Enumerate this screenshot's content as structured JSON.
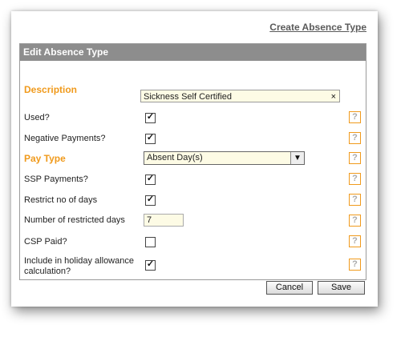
{
  "header": {
    "create_link": "Create Absence Type"
  },
  "panel": {
    "title": "Edit Absence Type"
  },
  "form": {
    "description_label": "Description",
    "description_value": "Sickness Self Certified",
    "description_clear": "×",
    "used_label": "Used?",
    "used_checked": true,
    "negative_payments_label": "Negative Payments?",
    "negative_payments_checked": true,
    "pay_type_label": "Pay Type",
    "pay_type_value": "Absent Day(s)",
    "ssp_payments_label": "SSP Payments?",
    "ssp_payments_checked": true,
    "restrict_days_label": "Restrict no of days",
    "restrict_days_checked": true,
    "restricted_days_label": "Number of restricted days",
    "restricted_days_value": "7",
    "csp_paid_label": "CSP Paid?",
    "csp_paid_checked": false,
    "holiday_label_line1": "Include in holiday allowance",
    "holiday_label_line2": "calculation?",
    "holiday_checked": true,
    "check_glyph": "✓",
    "help_glyph": "?"
  },
  "buttons": {
    "cancel": "Cancel",
    "save": "Save"
  },
  "colors": {
    "accent": "#f09a1c",
    "header_bg": "#8d8d8d",
    "input_bg": "#fdfbe5"
  }
}
